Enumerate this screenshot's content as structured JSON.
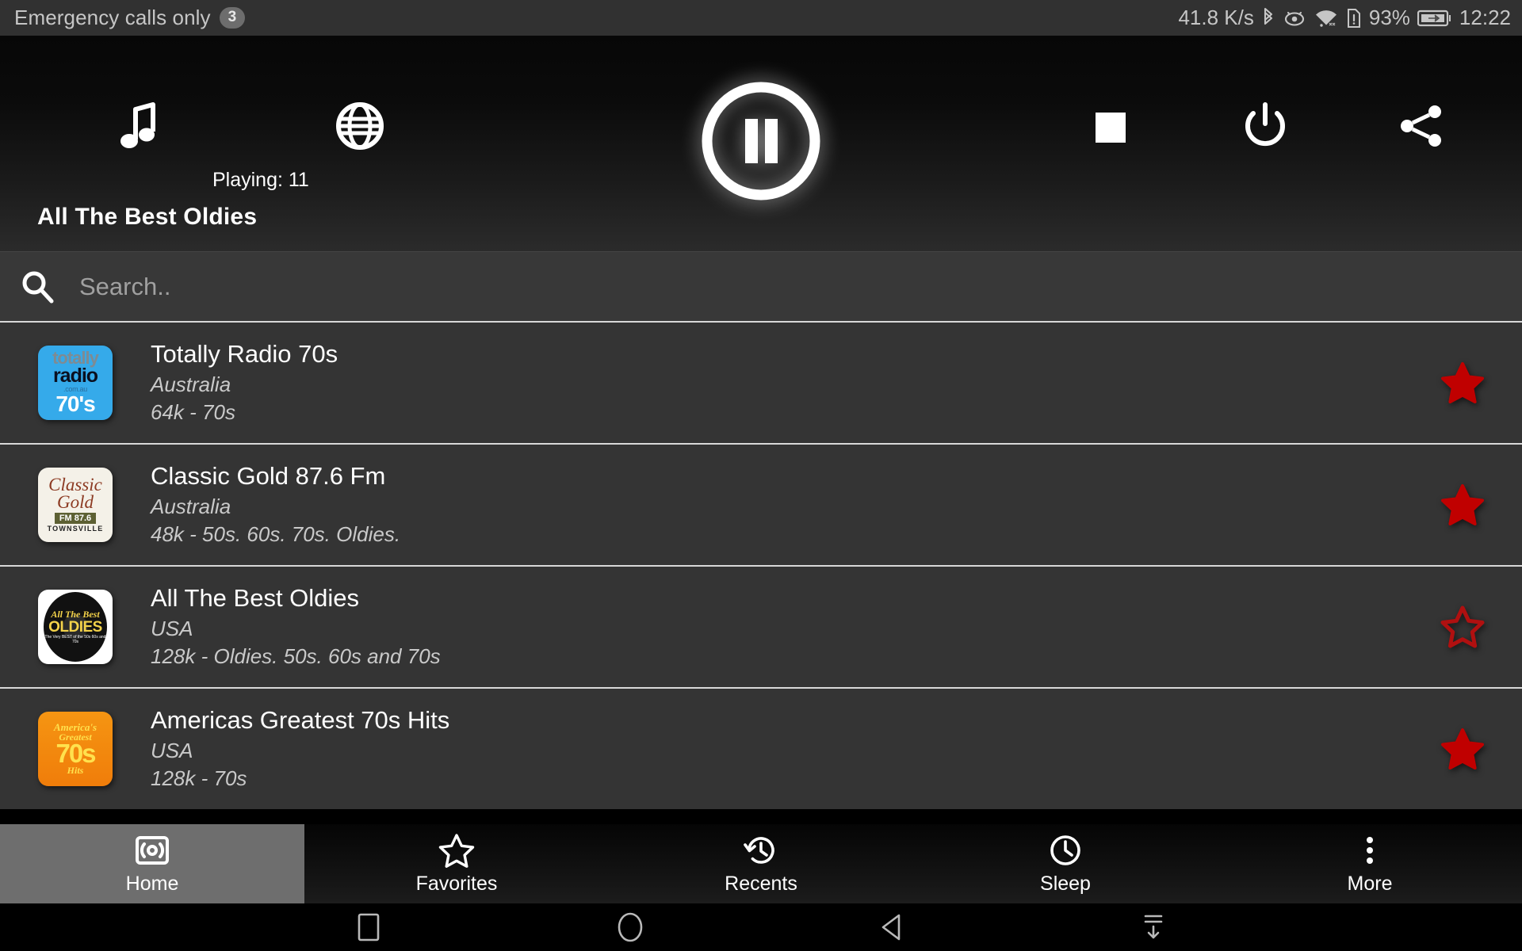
{
  "statusbar": {
    "carrier": "Emergency calls only",
    "notification_count": "3",
    "network_speed": "41.8 K/s",
    "battery_percent": "93%",
    "clock": "12:22",
    "icons": [
      "bluetooth-icon",
      "eye-icon",
      "wifi-icon",
      "sim-alert-icon",
      "battery-charging-icon"
    ]
  },
  "player": {
    "music_icon": "music-note-icon",
    "globe_icon": "globe-icon",
    "playing_label": "Playing: 11",
    "play_state": "pause",
    "stop_icon": "stop-icon",
    "power_icon": "power-icon",
    "share_icon": "share-icon"
  },
  "header": {
    "now_playing_title": "All The Best Oldies"
  },
  "search": {
    "icon": "search-icon",
    "placeholder": "Search..",
    "value": ""
  },
  "colors": {
    "star_filled": "#c00000",
    "star_empty": "#b01010",
    "list_bg": "#343434",
    "search_bg": "#383838",
    "nav_active_bg": "#6e6e6e",
    "separator": "#d8d8d8"
  },
  "stations": [
    {
      "name": "Totally Radio 70s",
      "country": "Australia",
      "description": "64k - 70s",
      "favorite": true,
      "logo": "totally-radio-70s-logo",
      "logo_lines": [
        "totally",
        "radio",
        ".com.au",
        "70's"
      ]
    },
    {
      "name": "Classic Gold 87.6 Fm",
      "country": "Australia",
      "description": "48k - 50s. 60s. 70s. Oldies.",
      "favorite": true,
      "logo": "classic-gold-logo",
      "logo_lines": [
        "Classic",
        "Gold",
        "FM 87.6",
        "TOWNSVILLE"
      ]
    },
    {
      "name": "All The Best Oldies",
      "country": "USA",
      "description": "128k - Oldies. 50s. 60s and 70s",
      "favorite": false,
      "logo": "all-the-best-oldies-logo",
      "logo_lines": [
        "All The Best",
        "OLDIES",
        "The Very BEST of the 50s 60s and 70s"
      ]
    },
    {
      "name": "Americas Greatest 70s Hits",
      "country": "USA",
      "description": "128k - 70s",
      "favorite": true,
      "logo": "americas-greatest-70s-hits-logo",
      "logo_lines": [
        "America's",
        "Greatest",
        "70s",
        "Hits"
      ]
    }
  ],
  "bottomnav": {
    "items": [
      {
        "label": "Home",
        "icon": "broadcast-icon",
        "active": true
      },
      {
        "label": "Favorites",
        "icon": "star-outline-icon",
        "active": false
      },
      {
        "label": "Recents",
        "icon": "history-icon",
        "active": false
      },
      {
        "label": "Sleep",
        "icon": "clock-icon",
        "active": false
      },
      {
        "label": "More",
        "icon": "overflow-dots-icon",
        "active": false
      }
    ]
  },
  "sysnav": {
    "buttons": [
      "recents-square-icon",
      "home-circle-icon",
      "back-triangle-icon",
      "hide-keyboard-icon"
    ]
  }
}
